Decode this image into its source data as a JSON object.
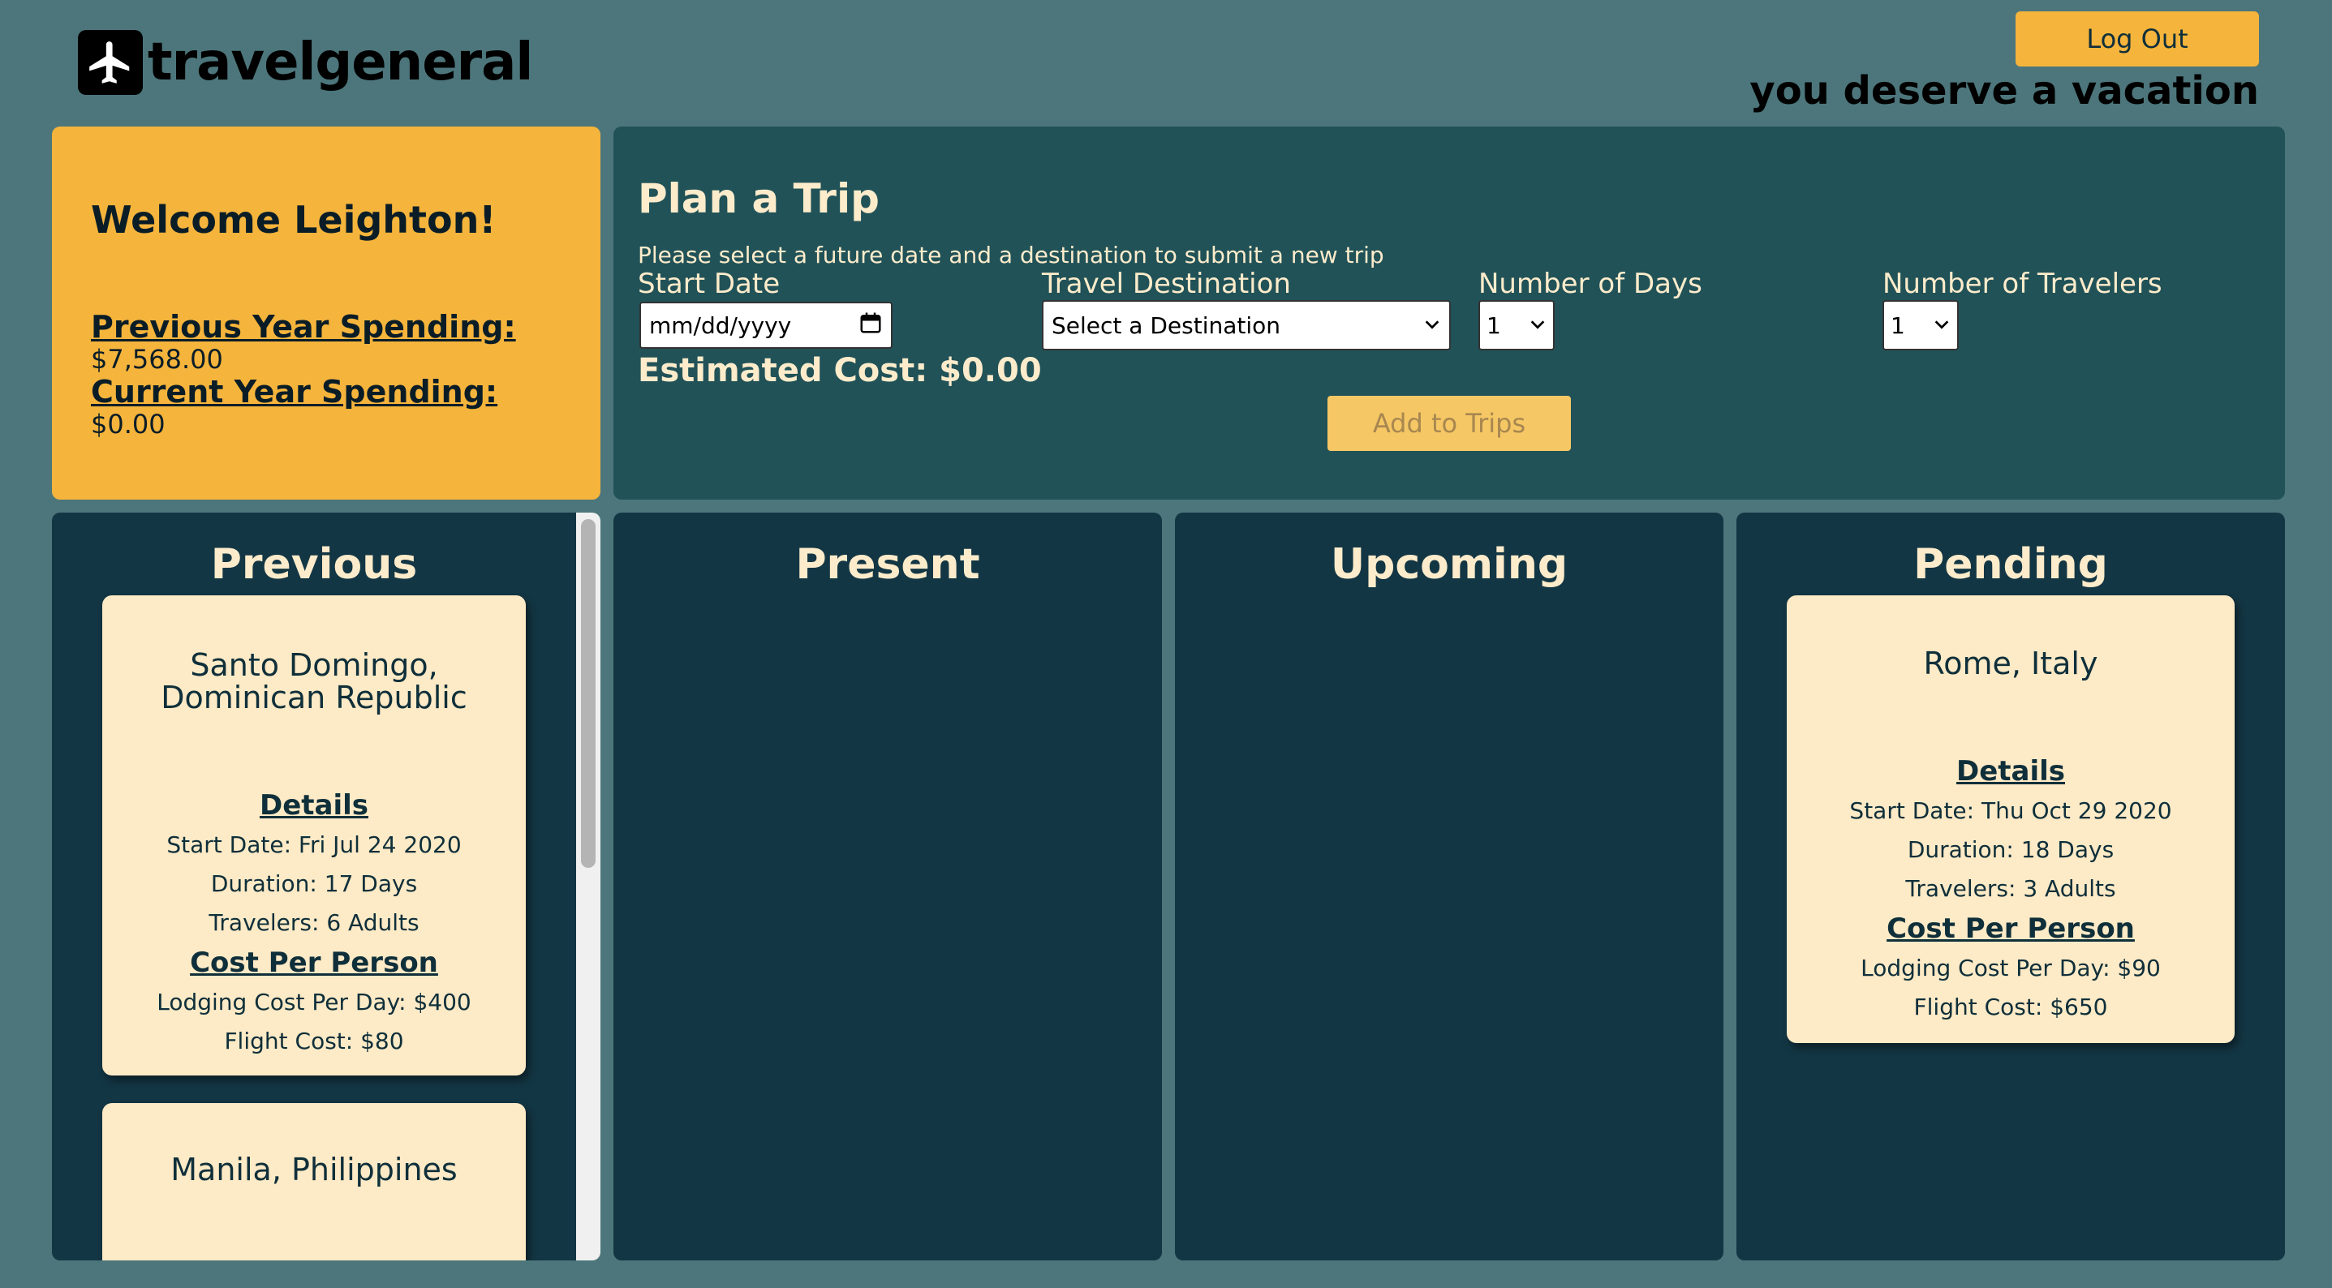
{
  "header": {
    "logo_text": "travelgeneral",
    "logout_label": "Log Out",
    "tagline": "you deserve a vacation"
  },
  "welcome": {
    "title": "Welcome Leighton!",
    "prev_label": "Previous Year Spending:",
    "prev_value": "$7,568.00",
    "curr_label": "Current Year Spending:",
    "curr_value": "$0.00"
  },
  "plan": {
    "title": "Plan a Trip",
    "instructions": "Please select a future date and a destination to submit a new trip",
    "start_label": "Start Date",
    "start_placeholder": "mm/dd/yyyy",
    "dest_label": "Travel Destination",
    "dest_selected": "Select a Destination",
    "days_label": "Number of Days",
    "days_selected": "1",
    "travelers_label": "Number of Travelers",
    "travelers_selected": "1",
    "est_cost": "Estimated Cost: $0.00",
    "add_label": "Add to Trips"
  },
  "columns": {
    "previous": "Previous",
    "present": "Present",
    "upcoming": "Upcoming",
    "pending": "Pending"
  },
  "previous_trips": [
    {
      "destination": "Santo Domingo, Dominican Republic",
      "details_label": "Details",
      "start": "Start Date: Fri Jul 24 2020",
      "duration": "Duration: 17 Days",
      "travelers": "Travelers: 6 Adults",
      "cost_label": "Cost Per Person",
      "lodging": "Lodging Cost Per Day: $400",
      "flight": "Flight Cost: $80"
    },
    {
      "destination": "Manila, Philippines"
    }
  ],
  "pending_trips": [
    {
      "destination": "Rome, Italy",
      "details_label": "Details",
      "start": "Start Date: Thu Oct 29 2020",
      "duration": "Duration: 18 Days",
      "travelers": "Travelers: 3 Adults",
      "cost_label": "Cost Per Person",
      "lodging": "Lodging Cost Per Day: $90",
      "flight": "Flight Cost: $650"
    }
  ],
  "icons": {
    "logo": "airplane-icon",
    "calendar": "calendar-icon",
    "dropdown": "chevron-down-icon"
  },
  "colors": {
    "background": "#4c767b",
    "accent": "#f5b43c",
    "plan_panel": "#215258",
    "column": "#133644",
    "card": "#fdeac6",
    "text_light": "#fdeccb"
  }
}
